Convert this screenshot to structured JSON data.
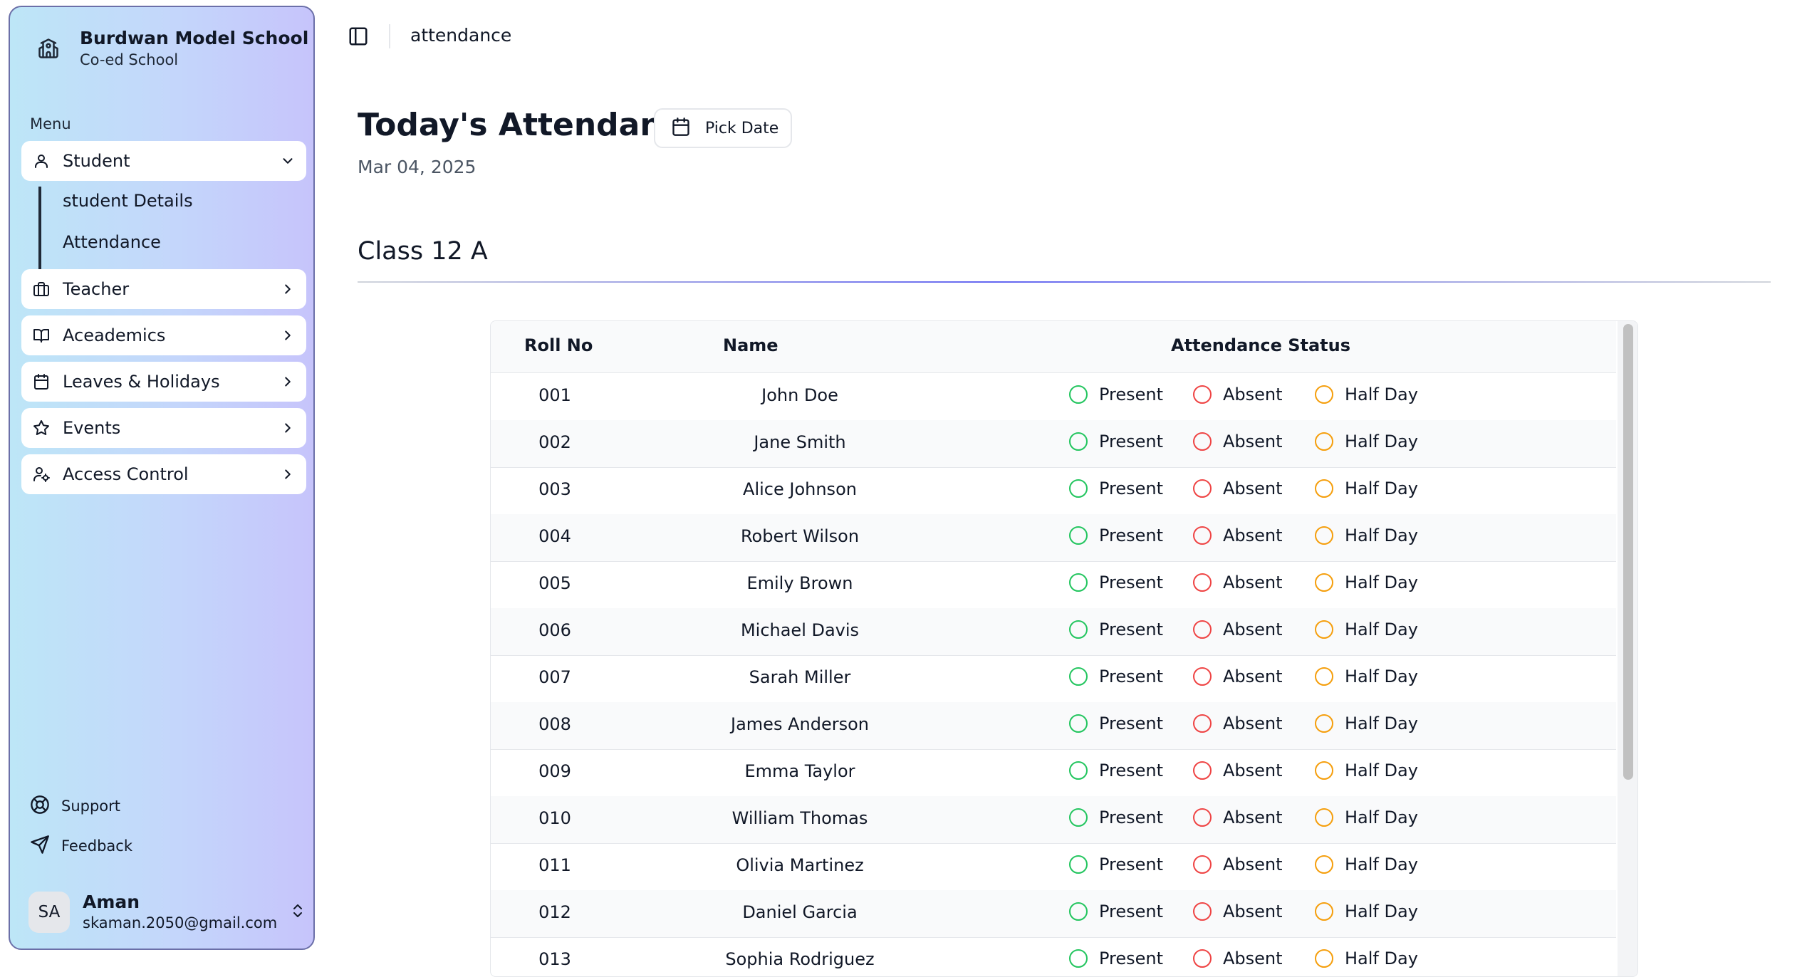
{
  "school": {
    "name": "Burdwan Model School",
    "type": "Co-ed School"
  },
  "menu_label": "Menu",
  "nav": {
    "student": "Student",
    "sub_items": [
      "student Details",
      "Attendance"
    ],
    "teacher": "Teacher",
    "academics": "Aceademics",
    "leaves": "Leaves & Holidays",
    "events": "Events",
    "access": "Access Control"
  },
  "footer": {
    "support": "Support",
    "feedback": "Feedback"
  },
  "user": {
    "initials": "SA",
    "name": "Aman",
    "email": "skaman.2050@gmail.com"
  },
  "breadcrumb": "attendance",
  "page": {
    "title": "Today's Attendance",
    "pick_date": "Pick Date",
    "date": "Mar 04, 2025",
    "class_title": "Class 12 A"
  },
  "table": {
    "headers": {
      "roll": "Roll No",
      "name": "Name",
      "status": "Attendance Status"
    },
    "options": {
      "present": "Present",
      "absent": "Absent",
      "half": "Half Day"
    },
    "rows": [
      {
        "roll": "001",
        "name": "John Doe"
      },
      {
        "roll": "002",
        "name": "Jane Smith"
      },
      {
        "roll": "003",
        "name": "Alice Johnson"
      },
      {
        "roll": "004",
        "name": "Robert Wilson"
      },
      {
        "roll": "005",
        "name": "Emily Brown"
      },
      {
        "roll": "006",
        "name": "Michael Davis"
      },
      {
        "roll": "007",
        "name": "Sarah Miller"
      },
      {
        "roll": "008",
        "name": "James Anderson"
      },
      {
        "roll": "009",
        "name": "Emma Taylor"
      },
      {
        "roll": "010",
        "name": "William Thomas"
      },
      {
        "roll": "011",
        "name": "Olivia Martinez"
      },
      {
        "roll": "012",
        "name": "Daniel Garcia"
      },
      {
        "roll": "013",
        "name": "Sophia Rodriguez"
      }
    ]
  },
  "colors": {
    "present": "#22c55e",
    "absent": "#ef4444",
    "half": "#f59e0b"
  }
}
